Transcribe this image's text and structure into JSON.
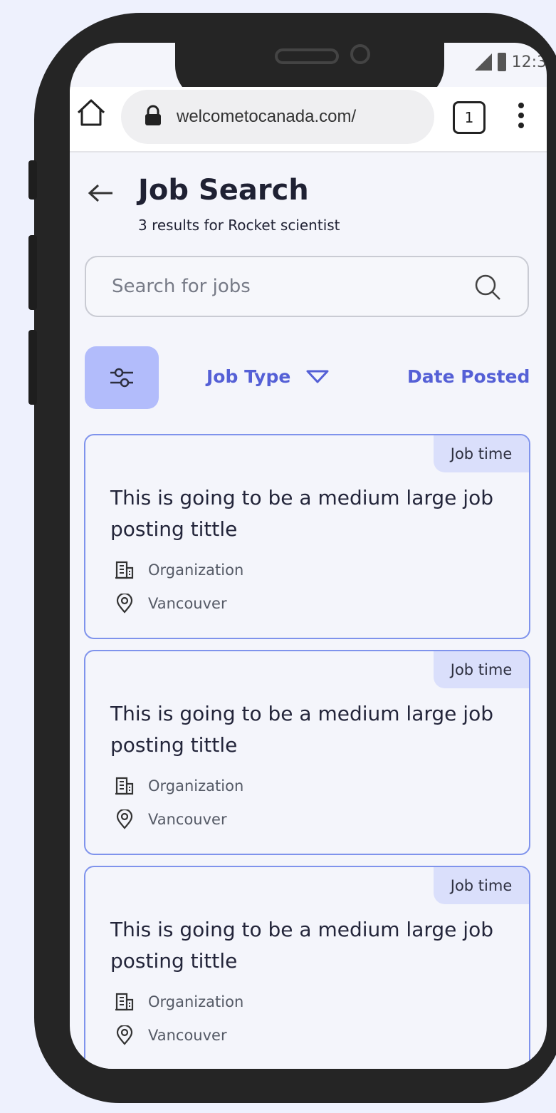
{
  "status_bar": {
    "time": "12:3"
  },
  "browser": {
    "url": "welcometocanada.com/",
    "tab_count": "1"
  },
  "header": {
    "title": "Job Search",
    "subtitle": "3 results for Rocket scientist"
  },
  "search": {
    "placeholder": "Search  for jobs"
  },
  "filters": {
    "job_type_label": "Job Type",
    "date_posted_label": "Date Posted"
  },
  "jobs": [
    {
      "badge": "Job time",
      "title": "This is going to be a medium large job posting tittle",
      "organization": "Organization",
      "location": "Vancouver"
    },
    {
      "badge": "Job time",
      "title": "This is going to be a medium large job posting tittle",
      "organization": "Organization",
      "location": "Vancouver"
    },
    {
      "badge": "Job time",
      "title": "This is going to be a medium large job posting tittle",
      "organization": "Organization",
      "location": "Vancouver"
    }
  ],
  "colors": {
    "accent": "#5560d6",
    "filter_button": "#b2bcfb",
    "card_border": "#7f93ec",
    "badge_bg": "#dadffb",
    "page_bg": "#eef1fd"
  },
  "icons": [
    "home-icon",
    "lock-icon",
    "tabs-icon",
    "kebab-menu-icon",
    "back-arrow-icon",
    "search-icon",
    "filter-sliders-icon",
    "dropdown-triangle-icon",
    "building-icon",
    "location-pin-icon"
  ]
}
